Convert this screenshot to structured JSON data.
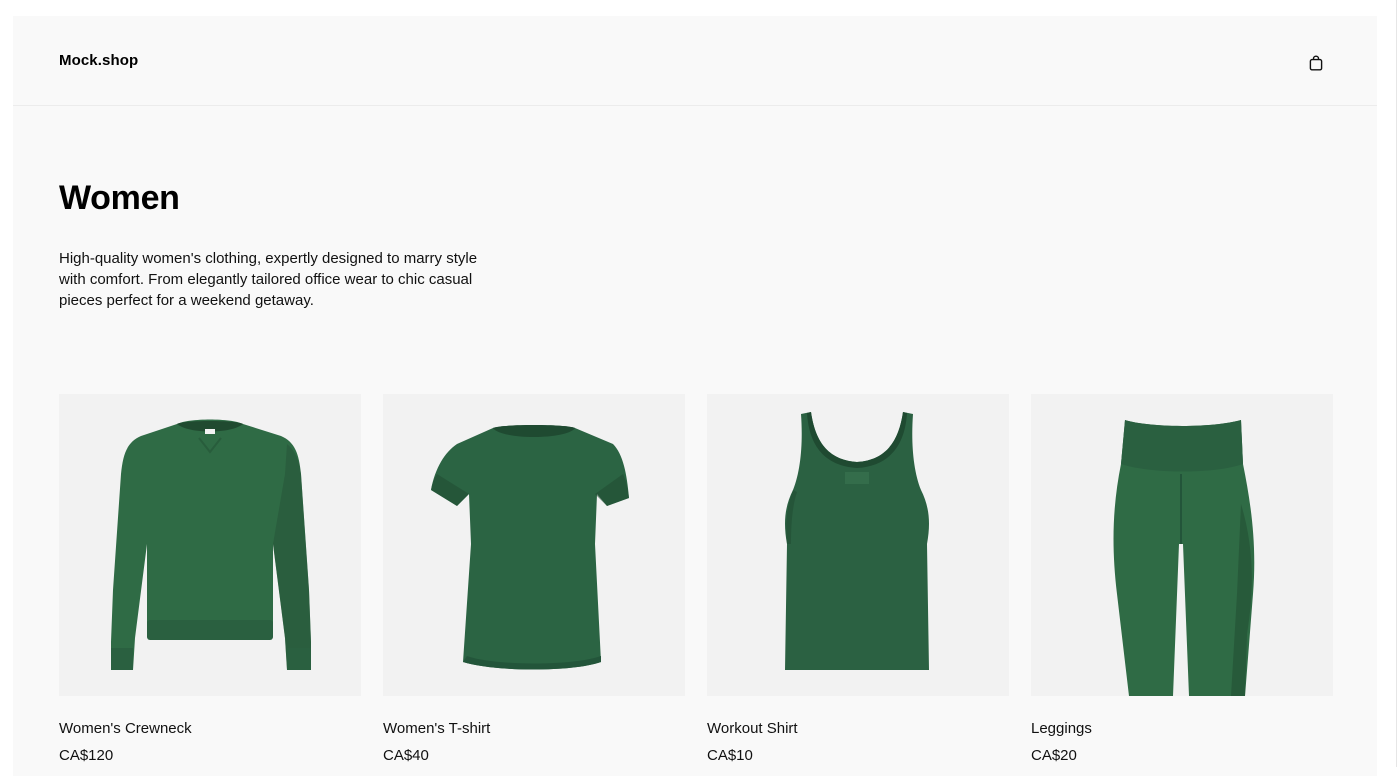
{
  "header": {
    "logo": "Mock.shop",
    "cart_icon": "shopping-bag-icon"
  },
  "collection": {
    "title": "Women",
    "description": "High-quality women's clothing, expertly designed to marry style with comfort. From elegantly tailored office wear to chic casual pieces perfect for a weekend getaway."
  },
  "products": [
    {
      "name": "Women's Crewneck",
      "price": "CA$120",
      "image_icon": "green-crewneck-sweater-image"
    },
    {
      "name": "Women's T-shirt",
      "price": "CA$40",
      "image_icon": "green-t-shirt-image"
    },
    {
      "name": "Workout Shirt",
      "price": "CA$10",
      "image_icon": "green-tank-top-image"
    },
    {
      "name": "Leggings",
      "price": "CA$20",
      "image_icon": "green-leggings-image"
    }
  ],
  "colors": {
    "page_background": "#f9f9f9",
    "image_background": "#f2f2f2",
    "garment_green": "#2f6b45",
    "garment_shadow": "#234f33",
    "text": "#111111"
  }
}
